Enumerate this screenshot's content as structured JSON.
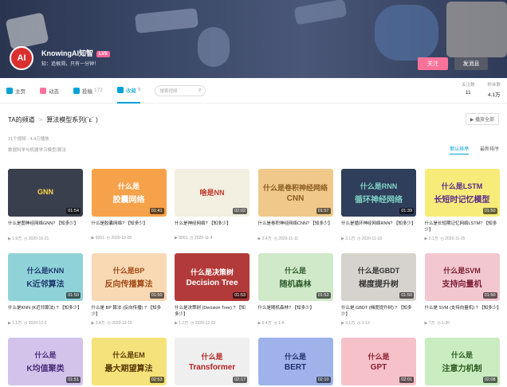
{
  "header": {
    "avatar_text": "AI",
    "username": "KnowingAI知智",
    "level": "LV5",
    "signature": "知：追根溯，只有一分钟！",
    "follow": "关注",
    "message": "发消息"
  },
  "nav": {
    "items": [
      {
        "label": "主页",
        "count": "",
        "color": "#00a1d6"
      },
      {
        "label": "动态",
        "count": "",
        "color": "#fb7299"
      },
      {
        "label": "投稿",
        "count": "172",
        "color": "#00a1d6"
      },
      {
        "label": "收藏",
        "count": "6",
        "color": "#00a1d6"
      }
    ],
    "search_placeholder": "搜索视频",
    "stats": [
      {
        "label": "关注数",
        "value": "11"
      },
      {
        "label": "粉丝数",
        "value": "4.1万"
      }
    ]
  },
  "crumb": {
    "root": "TA的频道",
    "current": "算法模型系列(`ε´ )",
    "play_all": "播放全部"
  },
  "meta": {
    "line1": "21个视频 · 4.4万播放",
    "line2": "数据科学与机器学习模型/算法",
    "sort_default": "默认排序",
    "sort_latest": "最新排序"
  },
  "videos": [
    {
      "t1": "GNN",
      "t2": "",
      "bg": "#3a3f4e",
      "fg": "#ffd54a",
      "dur": "01:54",
      "title": "什么是图神经网络GNN? 【知多少】",
      "plays": "1.9万",
      "date": "2020-10-21"
    },
    {
      "t1": "什么是",
      "t2": "胶囊网络",
      "bg": "#f6a24a",
      "fg": "#ffffff",
      "dur": "01:41",
      "title": "什么是胶囊网络? 【知多少】",
      "plays": "5091",
      "date": "2020-10-28"
    },
    {
      "t1": "啥是NN",
      "t2": "",
      "bg": "#f3efe1",
      "fg": "#c0392b",
      "dur": "02:02",
      "title": "什么是神经网络? 【知多少】",
      "plays": "8001",
      "date": "2020-11-4"
    },
    {
      "t1": "什么是卷积神经网络",
      "t2": "CNN",
      "bg": "#f0c98a",
      "fg": "#8a5a1e",
      "dur": "01:57",
      "title": "什么是卷积神经网络CNN? 【知多少】",
      "plays": "3.4万",
      "date": "2020-11-11"
    },
    {
      "t1": "什么是RNN",
      "t2": "循环神经网络",
      "bg": "#2f3e5a",
      "fg": "#7fd4c8",
      "dur": "01:39",
      "title": "什么是循环神经网络RNN? 【知多少】",
      "plays": "2.1万",
      "date": "2020-11-18"
    },
    {
      "t1": "什么是LSTM",
      "t2": "长短时记忆模型",
      "bg": "#f7ec7a",
      "fg": "#5a2b8a",
      "dur": "01:50",
      "title": "什么是长短期记忆网络LSTM? 【知多少】",
      "plays": "3.1万",
      "date": "2020-11-25"
    },
    {
      "t1": "什么是KNN",
      "t2": "K近邻算法",
      "bg": "#8fd3d8",
      "fg": "#1f3a6e",
      "dur": "01:50",
      "title": "什么是KNN (K近邻算法) ? 【知多少】",
      "plays": "1.1万",
      "date": "2020-12-2"
    },
    {
      "t1": "什么是BP",
      "t2": "反向传播算法",
      "bg": "#f9d9b4",
      "fg": "#a14a14",
      "dur": "01:50",
      "title": "什么是 BP 算法 (反向传播) ? 【知多少】",
      "plays": "3.4万",
      "date": "2020-12-16"
    },
    {
      "t1": "什么是决策树",
      "t2": "Decision Tree",
      "bg": "#b33a3a",
      "fg": "#ffffff",
      "dur": "01:53",
      "title": "什么是决策树 (Decision Tree) ? 【知多少】",
      "plays": "1.2万",
      "date": "2020-12-23"
    },
    {
      "t1": "什么是",
      "t2": "随机森林",
      "bg": "#cfe9c9",
      "fg": "#2e5d2a",
      "dur": "01:53",
      "title": "什么是随机森林? 【知多少】",
      "plays": "9.4万",
      "date": "1-6"
    },
    {
      "t1": "什么是GBDT",
      "t2": "梯度提升树",
      "bg": "#d6d3cf",
      "fg": "#333333",
      "dur": "01:50",
      "title": "什么是 GBDT (梯度提升树) ? 【知多少】",
      "plays": "3.1万",
      "date": "1-13"
    },
    {
      "t1": "什么是SVM",
      "t2": "支持向量机",
      "bg": "#f3c7cf",
      "fg": "#7a1f32",
      "dur": "01:50",
      "title": "什么是 SVM (支持向量机) ? 【知多少】",
      "plays": "7万",
      "date": "1-20"
    },
    {
      "t1": "什么是",
      "t2": "K均值聚类",
      "bg": "#d3c3ea",
      "fg": "#4a2c7a",
      "dur": "01:51",
      "title": "",
      "plays": "",
      "date": ""
    },
    {
      "t1": "什么是EM",
      "t2": "最大期望算法",
      "bg": "#f6e27a",
      "fg": "#5a3a0a",
      "dur": "02:53",
      "title": "",
      "plays": "",
      "date": ""
    },
    {
      "t1": "什么是",
      "t2": "Transformer",
      "bg": "#efefef",
      "fg": "#b22222",
      "dur": "02:17",
      "title": "",
      "plays": "",
      "date": ""
    },
    {
      "t1": "什么是",
      "t2": "BERT",
      "bg": "#9fb3ea",
      "fg": "#1f2f6e",
      "dur": "02:10",
      "title": "",
      "plays": "",
      "date": ""
    },
    {
      "t1": "什么是",
      "t2": "GPT",
      "bg": "#f6c1c8",
      "fg": "#8a1f2e",
      "dur": "02:01",
      "title": "",
      "plays": "",
      "date": ""
    },
    {
      "t1": "什么是",
      "t2": "注意力机制",
      "bg": "#c9ecc0",
      "fg": "#2a5a1e",
      "dur": "02:08",
      "title": "",
      "plays": "",
      "date": ""
    }
  ]
}
